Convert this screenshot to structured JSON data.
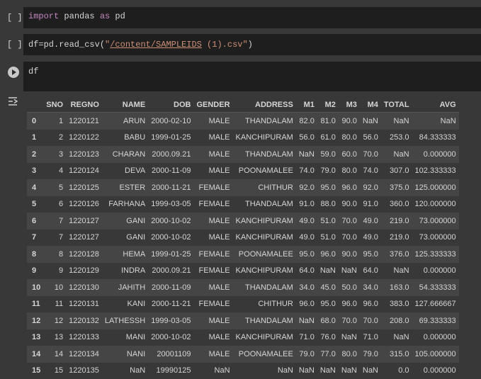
{
  "cells": [
    {
      "bracket": "[ ]",
      "tokens": [
        {
          "t": "import",
          "c": "kw"
        },
        {
          "t": " pandas ",
          "c": ""
        },
        {
          "t": "as",
          "c": "kw"
        },
        {
          "t": " pd",
          "c": ""
        }
      ]
    },
    {
      "bracket": "[ ]",
      "tokens": [
        {
          "t": "df=pd.read_csv(",
          "c": ""
        },
        {
          "t": "\"",
          "c": "str"
        },
        {
          "t": "/content/SAMPLEIDS",
          "c": "str ul"
        },
        {
          "t": " (1).csv\"",
          "c": "str"
        },
        {
          "t": ")",
          "c": ""
        }
      ]
    },
    {
      "bracket": "",
      "tokens": [
        {
          "t": "df",
          "c": ""
        }
      ]
    }
  ],
  "table": {
    "columns": [
      "",
      "SNO",
      "REGNO",
      "NAME",
      "DOB",
      "GENDER",
      "ADDRESS",
      "M1",
      "M2",
      "M3",
      "M4",
      "TOTAL",
      "AVG"
    ],
    "rows": [
      [
        "0",
        "1",
        "1220121",
        "ARUN",
        "2000-02-10",
        "MALE",
        "THANDALAM",
        "82.0",
        "81.0",
        "90.0",
        "NaN",
        "NaN",
        "NaN"
      ],
      [
        "1",
        "2",
        "1220122",
        "BABU",
        "1999-01-25",
        "MALE",
        "KANCHIPURAM",
        "56.0",
        "61.0",
        "80.0",
        "56.0",
        "253.0",
        "84.333333"
      ],
      [
        "2",
        "3",
        "1220123",
        "CHARAN",
        "2000.09.21",
        "MALE",
        "THANDALAM",
        "NaN",
        "59.0",
        "60.0",
        "70.0",
        "NaN",
        "0.000000"
      ],
      [
        "3",
        "4",
        "1220124",
        "DEVA",
        "2000-11-09",
        "MALE",
        "POONAMALEE",
        "74.0",
        "79.0",
        "80.0",
        "74.0",
        "307.0",
        "102.333333"
      ],
      [
        "4",
        "5",
        "1220125",
        "ESTER",
        "2000-11-21",
        "FEMALE",
        "CHITHUR",
        "92.0",
        "95.0",
        "96.0",
        "92.0",
        "375.0",
        "125.000000"
      ],
      [
        "5",
        "6",
        "1220126",
        "FARHANA",
        "1999-03-05",
        "FEMALE",
        "THANDALAM",
        "91.0",
        "88.0",
        "90.0",
        "91.0",
        "360.0",
        "120.000000"
      ],
      [
        "6",
        "7",
        "1220127",
        "GANI",
        "2000-10-02",
        "MALE",
        "KANCHIPURAM",
        "49.0",
        "51.0",
        "70.0",
        "49.0",
        "219.0",
        "73.000000"
      ],
      [
        "7",
        "7",
        "1220127",
        "GANI",
        "2000-10-02",
        "MALE",
        "KANCHIPURAM",
        "49.0",
        "51.0",
        "70.0",
        "49.0",
        "219.0",
        "73.000000"
      ],
      [
        "8",
        "8",
        "1220128",
        "HEMA",
        "1999-01-25",
        "FEMALE",
        "POONAMALEE",
        "95.0",
        "96.0",
        "90.0",
        "95.0",
        "376.0",
        "125.333333"
      ],
      [
        "9",
        "9",
        "1220129",
        "INDRA",
        "2000.09.21",
        "FEMALE",
        "KANCHIPURAM",
        "64.0",
        "NaN",
        "NaN",
        "64.0",
        "NaN",
        "0.000000"
      ],
      [
        "10",
        "10",
        "1220130",
        "JAHITH",
        "2000-11-09",
        "MALE",
        "THANDALAM",
        "34.0",
        "45.0",
        "50.0",
        "34.0",
        "163.0",
        "54.333333"
      ],
      [
        "11",
        "11",
        "1220131",
        "KANI",
        "2000-11-21",
        "FEMALE",
        "CHITHUR",
        "96.0",
        "95.0",
        "96.0",
        "96.0",
        "383.0",
        "127.666667"
      ],
      [
        "12",
        "12",
        "1220132",
        "LATHESSH",
        "1999-03-05",
        "MALE",
        "THANDALAM",
        "NaN",
        "68.0",
        "70.0",
        "70.0",
        "208.0",
        "69.333333"
      ],
      [
        "13",
        "13",
        "1220133",
        "MANI",
        "2000-10-02",
        "MALE",
        "KANCHIPURAM",
        "71.0",
        "76.0",
        "NaN",
        "71.0",
        "NaN",
        "0.000000"
      ],
      [
        "14",
        "14",
        "1220134",
        "NANI",
        "20001109",
        "MALE",
        "POONAMALEE",
        "79.0",
        "77.0",
        "80.0",
        "79.0",
        "315.0",
        "105.000000"
      ],
      [
        "15",
        "15",
        "1220135",
        "NaN",
        "19990125",
        "NaN",
        "NaN",
        "NaN",
        "NaN",
        "NaN",
        "NaN",
        "0.0",
        "0.000000"
      ]
    ]
  },
  "icons": {
    "run": "run-cell-icon",
    "output": "output-toggle-icon"
  }
}
